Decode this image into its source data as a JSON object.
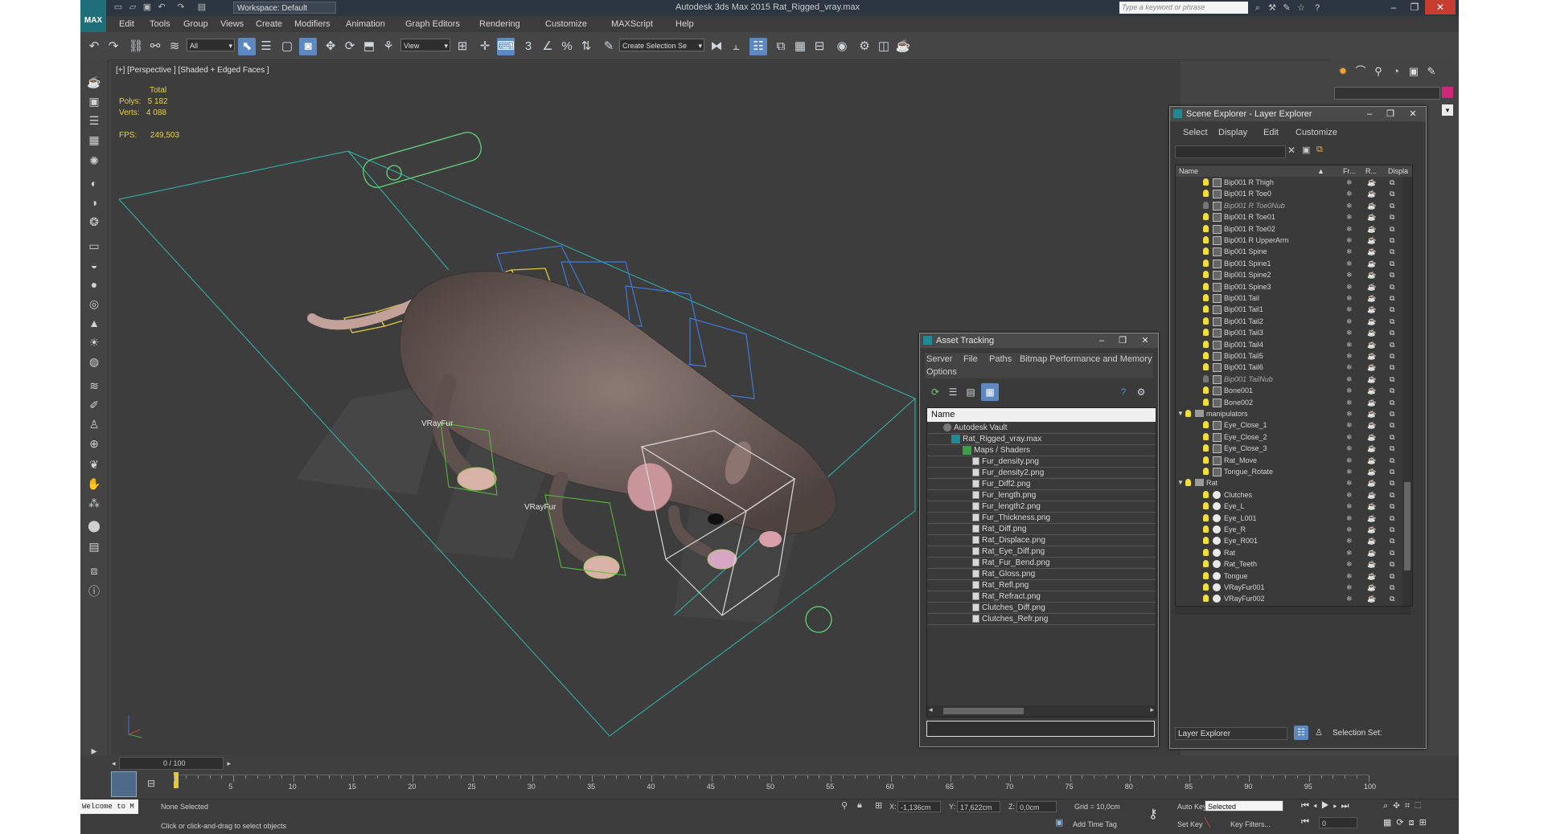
{
  "window": {
    "title": "Autodesk 3ds Max 2015     Rat_Rigged_vray.max",
    "workspace": "Workspace: Default",
    "search_placeholder": "Type a keyword or phrase",
    "logo": "MAX"
  },
  "menu": [
    "Edit",
    "Tools",
    "Group",
    "Views",
    "Create",
    "Modifiers",
    "Animation",
    "Graph Editors",
    "Rendering",
    "Customize",
    "MAXScript",
    "Help"
  ],
  "toolbar": {
    "selection_filter": "All",
    "reference_coord": "View",
    "named_selection": "Create Selection Se",
    "snap_label": "3"
  },
  "viewport": {
    "label": "[+] [Perspective ] [Shaded + Edged Faces ]",
    "stats": {
      "total_label": "Total",
      "polys_label": "Polys:",
      "polys": "5 182",
      "verts_label": "Verts:",
      "verts": "4 088",
      "fps_label": "FPS:",
      "fps": "249,503"
    },
    "annotations": [
      "VRayFur",
      "VRayFur"
    ]
  },
  "asset_tracking": {
    "title": "Asset Tracking",
    "menu": [
      "Server",
      "File",
      "Paths",
      "Bitmap Performance and Memory",
      "Options"
    ],
    "column": "Name",
    "rows": [
      {
        "label": "Autodesk Vault",
        "icon": "vault"
      },
      {
        "label": "Rat_Rigged_vray.max",
        "icon": "max"
      },
      {
        "label": "Maps / Shaders",
        "icon": "map"
      },
      {
        "label": "Fur_density.png",
        "icon": "file"
      },
      {
        "label": "Fur_density2.png",
        "icon": "file"
      },
      {
        "label": "Fur_Diff2.png",
        "icon": "file"
      },
      {
        "label": "Fur_length.png",
        "icon": "file"
      },
      {
        "label": "Fur_length2.png",
        "icon": "file"
      },
      {
        "label": "Fur_Thickness.png",
        "icon": "file"
      },
      {
        "label": "Rat_Diff.png",
        "icon": "file"
      },
      {
        "label": "Rat_Displace.png",
        "icon": "file"
      },
      {
        "label": "Rat_Eye_Diff.png",
        "icon": "file"
      },
      {
        "label": "Rat_Fur_Bend.png",
        "icon": "file"
      },
      {
        "label": "Rat_Gloss.png",
        "icon": "file"
      },
      {
        "label": "Rat_Refl.png",
        "icon": "file"
      },
      {
        "label": "Rat_Refract.png",
        "icon": "file"
      },
      {
        "label": "Clutches_Diff.png",
        "icon": "file"
      },
      {
        "label": "Clutches_Refr.png",
        "icon": "file"
      }
    ]
  },
  "scene_explorer": {
    "title": "Scene Explorer - Layer Explorer",
    "menu": [
      "Select",
      "Display",
      "Edit",
      "Customize"
    ],
    "columns": [
      "Name",
      "Fr...",
      "R...",
      "Displa"
    ],
    "rows": [
      {
        "label": "Bip001 R Thigh",
        "type": "bone",
        "italic": false
      },
      {
        "label": "Bip001 R Toe0",
        "type": "bone",
        "italic": false
      },
      {
        "label": "Bip001 R Toe0Nub",
        "type": "bone",
        "italic": true
      },
      {
        "label": "Bip001 R Toe01",
        "type": "bone",
        "italic": false
      },
      {
        "label": "Bip001 R Toe02",
        "type": "bone",
        "italic": false
      },
      {
        "label": "Bip001 R UpperArm",
        "type": "bone",
        "italic": false
      },
      {
        "label": "Bip001 Spine",
        "type": "bone",
        "italic": false
      },
      {
        "label": "Bip001 Spine1",
        "type": "bone",
        "italic": false
      },
      {
        "label": "Bip001 Spine2",
        "type": "bone",
        "italic": false
      },
      {
        "label": "Bip001 Spine3",
        "type": "bone",
        "italic": false
      },
      {
        "label": "Bip001 Tail",
        "type": "bone",
        "italic": false
      },
      {
        "label": "Bip001 Tail1",
        "type": "bone",
        "italic": false
      },
      {
        "label": "Bip001 Tail2",
        "type": "bone",
        "italic": false
      },
      {
        "label": "Bip001 Tail3",
        "type": "bone",
        "italic": false
      },
      {
        "label": "Bip001 Tail4",
        "type": "bone",
        "italic": false
      },
      {
        "label": "Bip001 Tail5",
        "type": "bone",
        "italic": false
      },
      {
        "label": "Bip001 Tail6",
        "type": "bone",
        "italic": false
      },
      {
        "label": "Bip001 TailNub",
        "type": "bone",
        "italic": true
      },
      {
        "label": "Bone001",
        "type": "bone",
        "italic": false
      },
      {
        "label": "Bone002",
        "type": "bone",
        "italic": false
      },
      {
        "label": "manipulators",
        "type": "layer",
        "italic": false
      },
      {
        "label": "Eye_Close_1",
        "type": "bone",
        "italic": false
      },
      {
        "label": "Eye_Close_2",
        "type": "bone",
        "italic": false
      },
      {
        "label": "Eye_Close_3",
        "type": "bone",
        "italic": false
      },
      {
        "label": "Rat_Move",
        "type": "bone",
        "italic": false
      },
      {
        "label": "Tongue_Rotate",
        "type": "bone",
        "italic": false
      },
      {
        "label": "Rat",
        "type": "layer",
        "italic": false
      },
      {
        "label": "Clutches",
        "type": "mesh",
        "italic": false
      },
      {
        "label": "Eye_L",
        "type": "mesh",
        "italic": false
      },
      {
        "label": "Eye_L001",
        "type": "mesh",
        "italic": false
      },
      {
        "label": "Eye_R",
        "type": "mesh",
        "italic": false
      },
      {
        "label": "Eye_R001",
        "type": "mesh",
        "italic": false
      },
      {
        "label": "Rat",
        "type": "mesh",
        "italic": false
      },
      {
        "label": "Rat_Teeth",
        "type": "mesh",
        "italic": false
      },
      {
        "label": "Tongue",
        "type": "mesh",
        "italic": false
      },
      {
        "label": "VRayFur001",
        "type": "mesh",
        "italic": false
      },
      {
        "label": "VRayFur002",
        "type": "mesh",
        "italic": false
      }
    ],
    "explorer_type": "Layer Explorer",
    "selection_set": "Selection Set:"
  },
  "timeline": {
    "frame": "0 / 100",
    "ticks": [
      "5",
      "10",
      "15",
      "20",
      "25",
      "30",
      "35",
      "40",
      "45",
      "50",
      "55",
      "60",
      "65",
      "70",
      "75",
      "80",
      "85",
      "90",
      "95",
      "100"
    ]
  },
  "status": {
    "maxscript": "Welcome to M",
    "selection": "None Selected",
    "prompt": "Click or click-and-drag to select objects",
    "x_label": "X:",
    "x": "-1,136cm",
    "y_label": "Y:",
    "y": "17,622cm",
    "z_label": "Z:",
    "z": "0,0cm",
    "grid": "Grid = 10,0cm",
    "add_time_tag": "Add Time Tag",
    "auto_key": "Auto Key",
    "auto_key_value": "Selected",
    "set_key": "Set Key",
    "key_filters": "Key Filters...",
    "frame_field": "0"
  },
  "colors": {
    "accent": "#5c89c2",
    "wire_cyan": "#2fb8b0",
    "bone_yellow": "#e0c840"
  }
}
